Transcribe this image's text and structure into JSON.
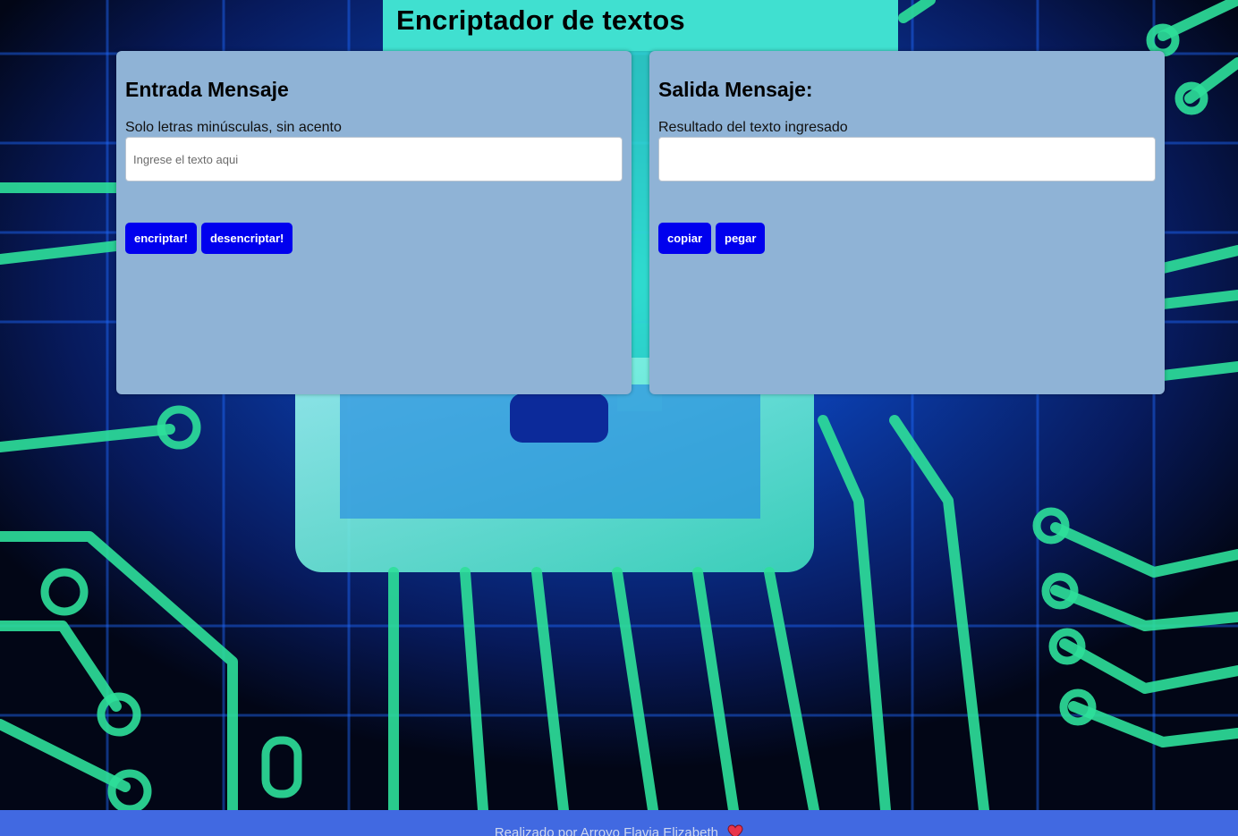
{
  "header": {
    "title": "Encriptador de textos"
  },
  "input_panel": {
    "title": "Entrada Mensaje",
    "hint": "Solo letras minúsculas, sin acento",
    "placeholder": "Ingrese el texto aqui",
    "value": "",
    "buttons": {
      "encrypt": "encriptar!",
      "decrypt": "desencriptar!"
    }
  },
  "output_panel": {
    "title": "Salida Mensaje:",
    "hint": "Resultado del texto ingresado",
    "value": "",
    "buttons": {
      "copy": "copiar",
      "paste": "pegar"
    }
  },
  "footer": {
    "credit": "Realizado por Arroyo Flavia Elizabeth",
    "icon": "heart-icon"
  },
  "colors": {
    "header_bg": "#40e0d0",
    "panel_bg": "#8fb3d6",
    "button_bg": "#0000ee",
    "footer_bg": "#4169e1",
    "circuit_green": "#2ee09a",
    "circuit_blue": "#1f5fff"
  }
}
